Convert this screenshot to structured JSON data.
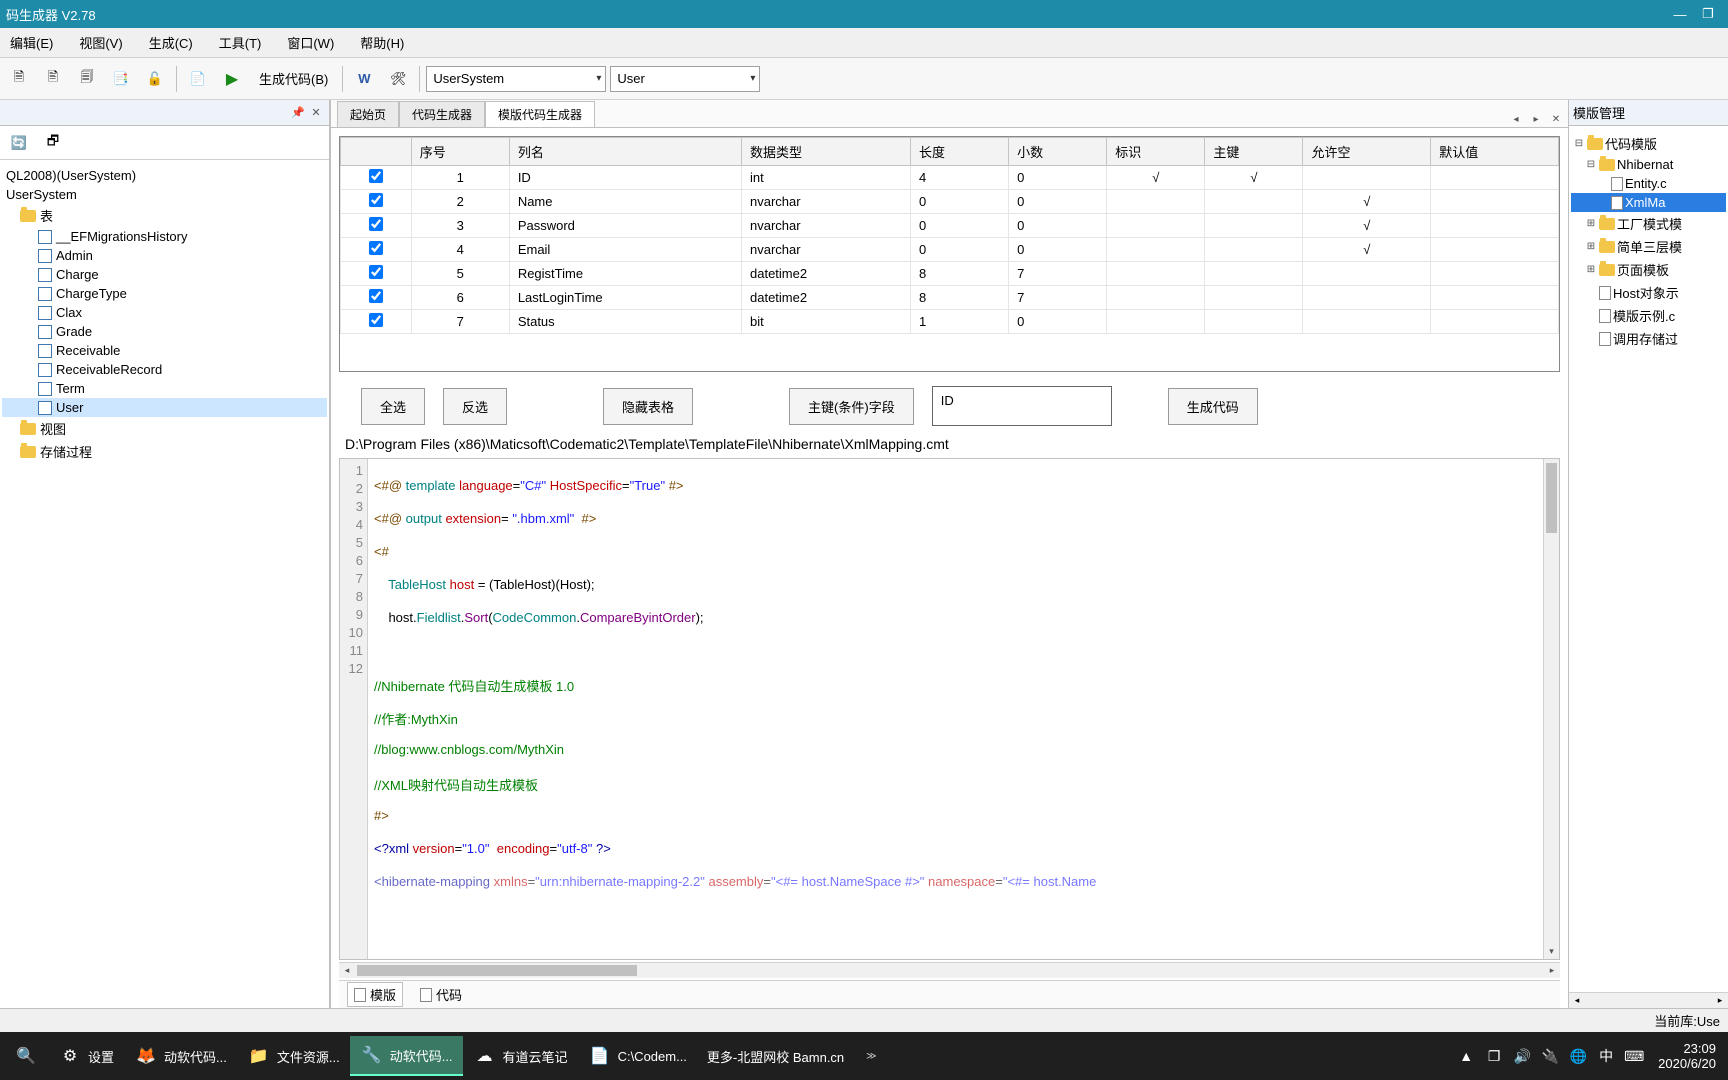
{
  "title": "码生成器  V2.78",
  "menu": [
    "编辑(E)",
    "视图(V)",
    "生成(C)",
    "工具(T)",
    "窗口(W)",
    "帮助(H)"
  ],
  "toolbar": {
    "gen_label": "生成代码(B)",
    "combo1": "UserSystem",
    "combo2": "User"
  },
  "left": {
    "db": "QL2008)(UserSystem)",
    "dbname": "UserSystem",
    "tables_label": "表",
    "tables": [
      "__EFMigrationsHistory",
      "Admin",
      "Charge",
      "ChargeType",
      "Clax",
      "Grade",
      "Receivable",
      "ReceivableRecord",
      "Term",
      "User"
    ],
    "selected_table": "User",
    "views_label": "视图",
    "procs_label": "存储过程"
  },
  "center": {
    "tabs": [
      "起始页",
      "代码生成器",
      "模版代码生成器"
    ],
    "active_tab": 2,
    "grid": {
      "cols": [
        "",
        "序号",
        "列名",
        "数据类型",
        "长度",
        "小数",
        "标识",
        "主键",
        "允许空",
        "默认值"
      ],
      "rows": [
        {
          "chk": true,
          "no": 1,
          "name": "ID",
          "dtype": "int",
          "len": "4",
          "dec": "0",
          "ident": "√",
          "pk": "√",
          "null": "",
          "def": ""
        },
        {
          "chk": true,
          "no": 2,
          "name": "Name",
          "dtype": "nvarchar",
          "len": "0",
          "dec": "0",
          "ident": "",
          "pk": "",
          "null": "√",
          "def": ""
        },
        {
          "chk": true,
          "no": 3,
          "name": "Password",
          "dtype": "nvarchar",
          "len": "0",
          "dec": "0",
          "ident": "",
          "pk": "",
          "null": "√",
          "def": ""
        },
        {
          "chk": true,
          "no": 4,
          "name": "Email",
          "dtype": "nvarchar",
          "len": "0",
          "dec": "0",
          "ident": "",
          "pk": "",
          "null": "√",
          "def": ""
        },
        {
          "chk": true,
          "no": 5,
          "name": "RegistTime",
          "dtype": "datetime2",
          "len": "8",
          "dec": "7",
          "ident": "",
          "pk": "",
          "null": "",
          "def": ""
        },
        {
          "chk": true,
          "no": 6,
          "name": "LastLoginTime",
          "dtype": "datetime2",
          "len": "8",
          "dec": "7",
          "ident": "",
          "pk": "",
          "null": "",
          "def": ""
        },
        {
          "chk": true,
          "no": 7,
          "name": "Status",
          "dtype": "bit",
          "len": "1",
          "dec": "0",
          "ident": "",
          "pk": "",
          "null": "",
          "def": ""
        }
      ]
    },
    "buttons": {
      "select_all": "全选",
      "invert": "反选",
      "hide_table": "隐藏表格",
      "pk_field": "主键(条件)字段",
      "id_value": "ID",
      "gen": "生成代码"
    },
    "path": "D:\\Program Files (x86)\\Maticsoft\\Codematic2\\Template\\TemplateFile\\Nhibernate\\XmlMapping.cmt",
    "bottom_tabs": [
      "模版",
      "代码"
    ]
  },
  "right": {
    "title": "模版管理",
    "nodes": [
      {
        "ind": 0,
        "exp": "⊟",
        "icon": "folder",
        "label": "代码模版"
      },
      {
        "ind": 1,
        "exp": "⊟",
        "icon": "folder",
        "label": "Nhibernat"
      },
      {
        "ind": 2,
        "exp": "",
        "icon": "doc",
        "label": "Entity.c"
      },
      {
        "ind": 2,
        "exp": "",
        "icon": "doc",
        "label": "XmlMa",
        "sel": true
      },
      {
        "ind": 1,
        "exp": "⊞",
        "icon": "folder",
        "label": "工厂模式模"
      },
      {
        "ind": 1,
        "exp": "⊞",
        "icon": "folder",
        "label": "简单三层模"
      },
      {
        "ind": 1,
        "exp": "⊞",
        "icon": "folder",
        "label": "页面模板"
      },
      {
        "ind": 1,
        "exp": "",
        "icon": "doc",
        "label": "Host对象示"
      },
      {
        "ind": 1,
        "exp": "",
        "icon": "doc",
        "label": "模版示例.c"
      },
      {
        "ind": 1,
        "exp": "",
        "icon": "doc",
        "label": "调用存储过"
      }
    ]
  },
  "status": {
    "right": "当前库:Use"
  },
  "taskbar": {
    "items": [
      {
        "icon": "⚙",
        "label": "设置"
      },
      {
        "icon": "🦊",
        "label": "动软代码..."
      },
      {
        "icon": "📁",
        "label": "文件资源..."
      },
      {
        "icon": "🔧",
        "label": "动软代码...",
        "active": true
      },
      {
        "icon": "☁",
        "label": "有道云笔记"
      },
      {
        "icon": "📄",
        "label": "C:\\Codem..."
      },
      {
        "icon": "",
        "label": "更多-北盟网校 Bamn.cn"
      }
    ],
    "tray": [
      "▲",
      "❐",
      "🔊",
      "🔌",
      "🌐",
      "中",
      "⌨"
    ],
    "time": "23:09",
    "date": "2020/6/20"
  }
}
